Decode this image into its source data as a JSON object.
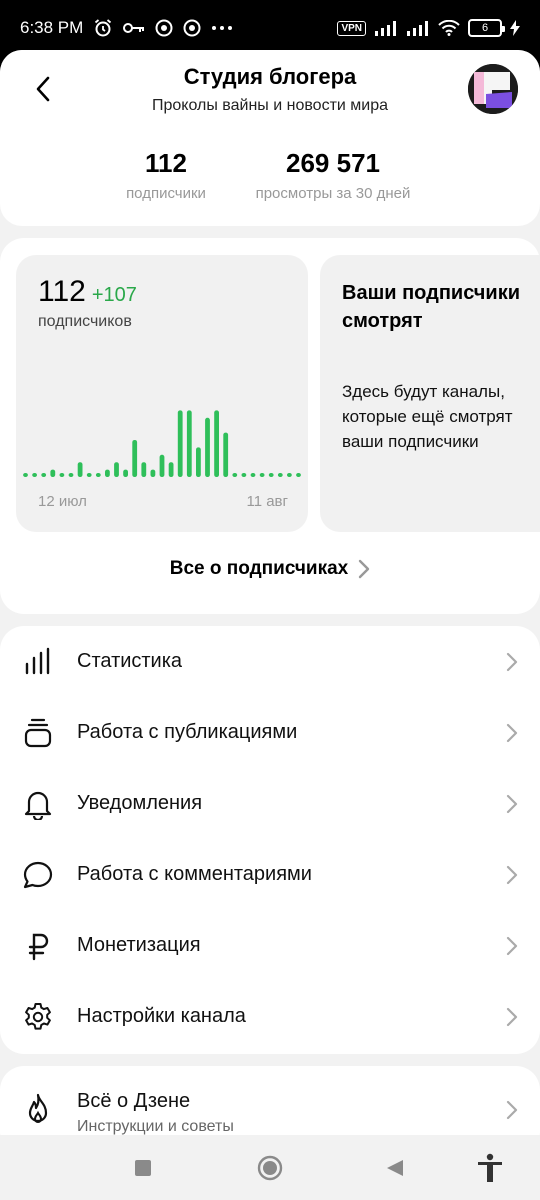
{
  "status_bar": {
    "time": "6:38 PM",
    "left_icons": [
      "alarm-icon",
      "key-icon",
      "chrome-icon",
      "chrome-icon",
      "more-dots-icon"
    ],
    "vpn": "VPN",
    "battery": "6"
  },
  "header": {
    "title": "Студия блогера",
    "subtitle": "Проколы вайны и новости мира",
    "stats": [
      {
        "value": "112",
        "label": "подписчики"
      },
      {
        "value": "269 571",
        "label": "просмотры за 30 дней"
      }
    ]
  },
  "subscribers_chart": {
    "total": "112",
    "delta": "+107",
    "label": "подписчиков",
    "x_start": "12 июл",
    "x_end": "11 авг",
    "accent_color": "#2fbf5a"
  },
  "chart_data": {
    "type": "bar",
    "categories": [
      "12 июл",
      "",
      "",
      "",
      "",
      "",
      "",
      "",
      "",
      "",
      "",
      "",
      "",
      "",
      "",
      "",
      "",
      "",
      "",
      "",
      "",
      "",
      "",
      "",
      "",
      "",
      "",
      "",
      "",
      "",
      "11 авг"
    ],
    "values": [
      0,
      0,
      0,
      1,
      0,
      0,
      2,
      0,
      0,
      1,
      2,
      1,
      5,
      2,
      1,
      3,
      2,
      9,
      9,
      4,
      8,
      9,
      6,
      0,
      0,
      0,
      0,
      0,
      0,
      0,
      0
    ],
    "xlabel": "",
    "ylabel": "",
    "ylim": [
      0,
      10
    ],
    "grid": false
  },
  "info_tile": {
    "title": "Ваши подписчики смотрят",
    "text": "Здесь будут каналы, которые ещё смотрят ваши подписчики"
  },
  "all_subscribers_link": "Все о подписчиках",
  "menu": [
    {
      "icon": "bar-chart-icon",
      "label": "Статистика"
    },
    {
      "icon": "publications-icon",
      "label": "Работа с публикациями"
    },
    {
      "icon": "bell-icon",
      "label": "Уведомления"
    },
    {
      "icon": "comment-bubble-icon",
      "label": "Работа с комментариями"
    },
    {
      "icon": "ruble-icon",
      "label": "Монетизация"
    },
    {
      "icon": "gear-icon",
      "label": "Настройки канала"
    }
  ],
  "zen": {
    "icon": "flame-icon",
    "title": "Всё о Дзене",
    "subtitle": "Инструкции и советы"
  },
  "nav_bar": {
    "buttons": [
      "square-icon",
      "home-circle-icon",
      "back-triangle-icon",
      "accessibility-icon"
    ]
  }
}
